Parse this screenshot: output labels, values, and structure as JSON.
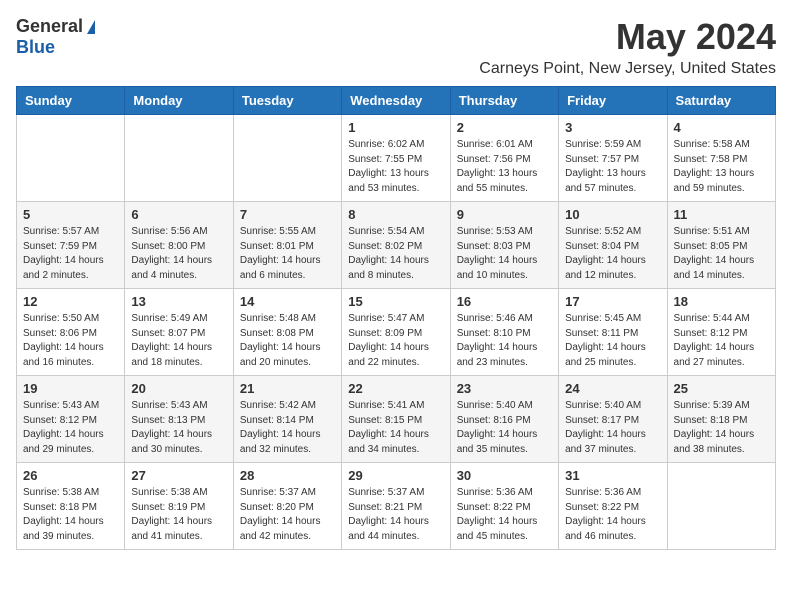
{
  "header": {
    "logo_general": "General",
    "logo_blue": "Blue",
    "month_title": "May 2024",
    "location": "Carneys Point, New Jersey, United States"
  },
  "days_of_week": [
    "Sunday",
    "Monday",
    "Tuesday",
    "Wednesday",
    "Thursday",
    "Friday",
    "Saturday"
  ],
  "weeks": [
    [
      {
        "day": "",
        "info": ""
      },
      {
        "day": "",
        "info": ""
      },
      {
        "day": "",
        "info": ""
      },
      {
        "day": "1",
        "info": "Sunrise: 6:02 AM\nSunset: 7:55 PM\nDaylight: 13 hours\nand 53 minutes."
      },
      {
        "day": "2",
        "info": "Sunrise: 6:01 AM\nSunset: 7:56 PM\nDaylight: 13 hours\nand 55 minutes."
      },
      {
        "day": "3",
        "info": "Sunrise: 5:59 AM\nSunset: 7:57 PM\nDaylight: 13 hours\nand 57 minutes."
      },
      {
        "day": "4",
        "info": "Sunrise: 5:58 AM\nSunset: 7:58 PM\nDaylight: 13 hours\nand 59 minutes."
      }
    ],
    [
      {
        "day": "5",
        "info": "Sunrise: 5:57 AM\nSunset: 7:59 PM\nDaylight: 14 hours\nand 2 minutes."
      },
      {
        "day": "6",
        "info": "Sunrise: 5:56 AM\nSunset: 8:00 PM\nDaylight: 14 hours\nand 4 minutes."
      },
      {
        "day": "7",
        "info": "Sunrise: 5:55 AM\nSunset: 8:01 PM\nDaylight: 14 hours\nand 6 minutes."
      },
      {
        "day": "8",
        "info": "Sunrise: 5:54 AM\nSunset: 8:02 PM\nDaylight: 14 hours\nand 8 minutes."
      },
      {
        "day": "9",
        "info": "Sunrise: 5:53 AM\nSunset: 8:03 PM\nDaylight: 14 hours\nand 10 minutes."
      },
      {
        "day": "10",
        "info": "Sunrise: 5:52 AM\nSunset: 8:04 PM\nDaylight: 14 hours\nand 12 minutes."
      },
      {
        "day": "11",
        "info": "Sunrise: 5:51 AM\nSunset: 8:05 PM\nDaylight: 14 hours\nand 14 minutes."
      }
    ],
    [
      {
        "day": "12",
        "info": "Sunrise: 5:50 AM\nSunset: 8:06 PM\nDaylight: 14 hours\nand 16 minutes."
      },
      {
        "day": "13",
        "info": "Sunrise: 5:49 AM\nSunset: 8:07 PM\nDaylight: 14 hours\nand 18 minutes."
      },
      {
        "day": "14",
        "info": "Sunrise: 5:48 AM\nSunset: 8:08 PM\nDaylight: 14 hours\nand 20 minutes."
      },
      {
        "day": "15",
        "info": "Sunrise: 5:47 AM\nSunset: 8:09 PM\nDaylight: 14 hours\nand 22 minutes."
      },
      {
        "day": "16",
        "info": "Sunrise: 5:46 AM\nSunset: 8:10 PM\nDaylight: 14 hours\nand 23 minutes."
      },
      {
        "day": "17",
        "info": "Sunrise: 5:45 AM\nSunset: 8:11 PM\nDaylight: 14 hours\nand 25 minutes."
      },
      {
        "day": "18",
        "info": "Sunrise: 5:44 AM\nSunset: 8:12 PM\nDaylight: 14 hours\nand 27 minutes."
      }
    ],
    [
      {
        "day": "19",
        "info": "Sunrise: 5:43 AM\nSunset: 8:12 PM\nDaylight: 14 hours\nand 29 minutes."
      },
      {
        "day": "20",
        "info": "Sunrise: 5:43 AM\nSunset: 8:13 PM\nDaylight: 14 hours\nand 30 minutes."
      },
      {
        "day": "21",
        "info": "Sunrise: 5:42 AM\nSunset: 8:14 PM\nDaylight: 14 hours\nand 32 minutes."
      },
      {
        "day": "22",
        "info": "Sunrise: 5:41 AM\nSunset: 8:15 PM\nDaylight: 14 hours\nand 34 minutes."
      },
      {
        "day": "23",
        "info": "Sunrise: 5:40 AM\nSunset: 8:16 PM\nDaylight: 14 hours\nand 35 minutes."
      },
      {
        "day": "24",
        "info": "Sunrise: 5:40 AM\nSunset: 8:17 PM\nDaylight: 14 hours\nand 37 minutes."
      },
      {
        "day": "25",
        "info": "Sunrise: 5:39 AM\nSunset: 8:18 PM\nDaylight: 14 hours\nand 38 minutes."
      }
    ],
    [
      {
        "day": "26",
        "info": "Sunrise: 5:38 AM\nSunset: 8:18 PM\nDaylight: 14 hours\nand 39 minutes."
      },
      {
        "day": "27",
        "info": "Sunrise: 5:38 AM\nSunset: 8:19 PM\nDaylight: 14 hours\nand 41 minutes."
      },
      {
        "day": "28",
        "info": "Sunrise: 5:37 AM\nSunset: 8:20 PM\nDaylight: 14 hours\nand 42 minutes."
      },
      {
        "day": "29",
        "info": "Sunrise: 5:37 AM\nSunset: 8:21 PM\nDaylight: 14 hours\nand 44 minutes."
      },
      {
        "day": "30",
        "info": "Sunrise: 5:36 AM\nSunset: 8:22 PM\nDaylight: 14 hours\nand 45 minutes."
      },
      {
        "day": "31",
        "info": "Sunrise: 5:36 AM\nSunset: 8:22 PM\nDaylight: 14 hours\nand 46 minutes."
      },
      {
        "day": "",
        "info": ""
      }
    ]
  ]
}
